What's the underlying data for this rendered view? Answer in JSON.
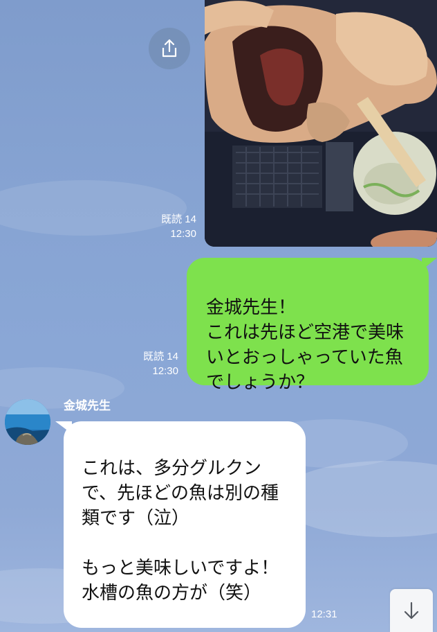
{
  "chat": {
    "photo_message": {
      "read_label": "既読 14",
      "time": "12:30",
      "share_icon": "share-icon"
    },
    "sent_message": {
      "text": "金城先生！\nこれは先ほど空港で美味いとおっしゃっていた魚でしょうか？",
      "read_label": "既読 14",
      "time": "12:30"
    },
    "received_message": {
      "sender": "金城先生",
      "text": "これは、多分グルクンで、先ほどの魚は別の種類です（泣）\n\nもっと美味しいですよ！\n水槽の魚の方が（笑）",
      "time": "12:31"
    },
    "scroll_down_icon": "chevron-down-icon"
  },
  "colors": {
    "background": "#86a3d2",
    "sent_bubble": "#7ee14d",
    "received_bubble": "#ffffff"
  }
}
